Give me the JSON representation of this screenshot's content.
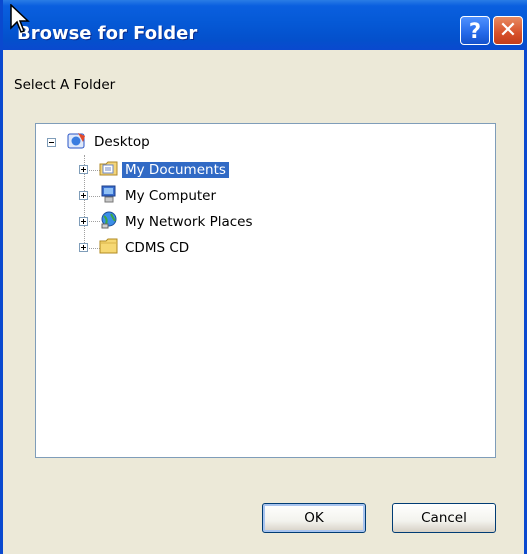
{
  "window": {
    "title": "Browse for Folder"
  },
  "titlebar_buttons": {
    "help": "?",
    "close": "✕"
  },
  "prompt": "Select A Folder",
  "tree": {
    "root": {
      "label": "Desktop",
      "icon": "desktop-icon"
    },
    "children": [
      {
        "label": "My Documents",
        "icon": "my-documents-icon",
        "selected": true
      },
      {
        "label": "My Computer",
        "icon": "my-computer-icon"
      },
      {
        "label": "My Network Places",
        "icon": "network-places-icon"
      },
      {
        "label": "CDMS CD",
        "icon": "folder-icon"
      }
    ]
  },
  "buttons": {
    "ok": "OK",
    "cancel": "Cancel"
  },
  "colors": {
    "titlebar": "#0559d6",
    "selection": "#316ac5",
    "dialog_bg": "#ece9d8"
  }
}
